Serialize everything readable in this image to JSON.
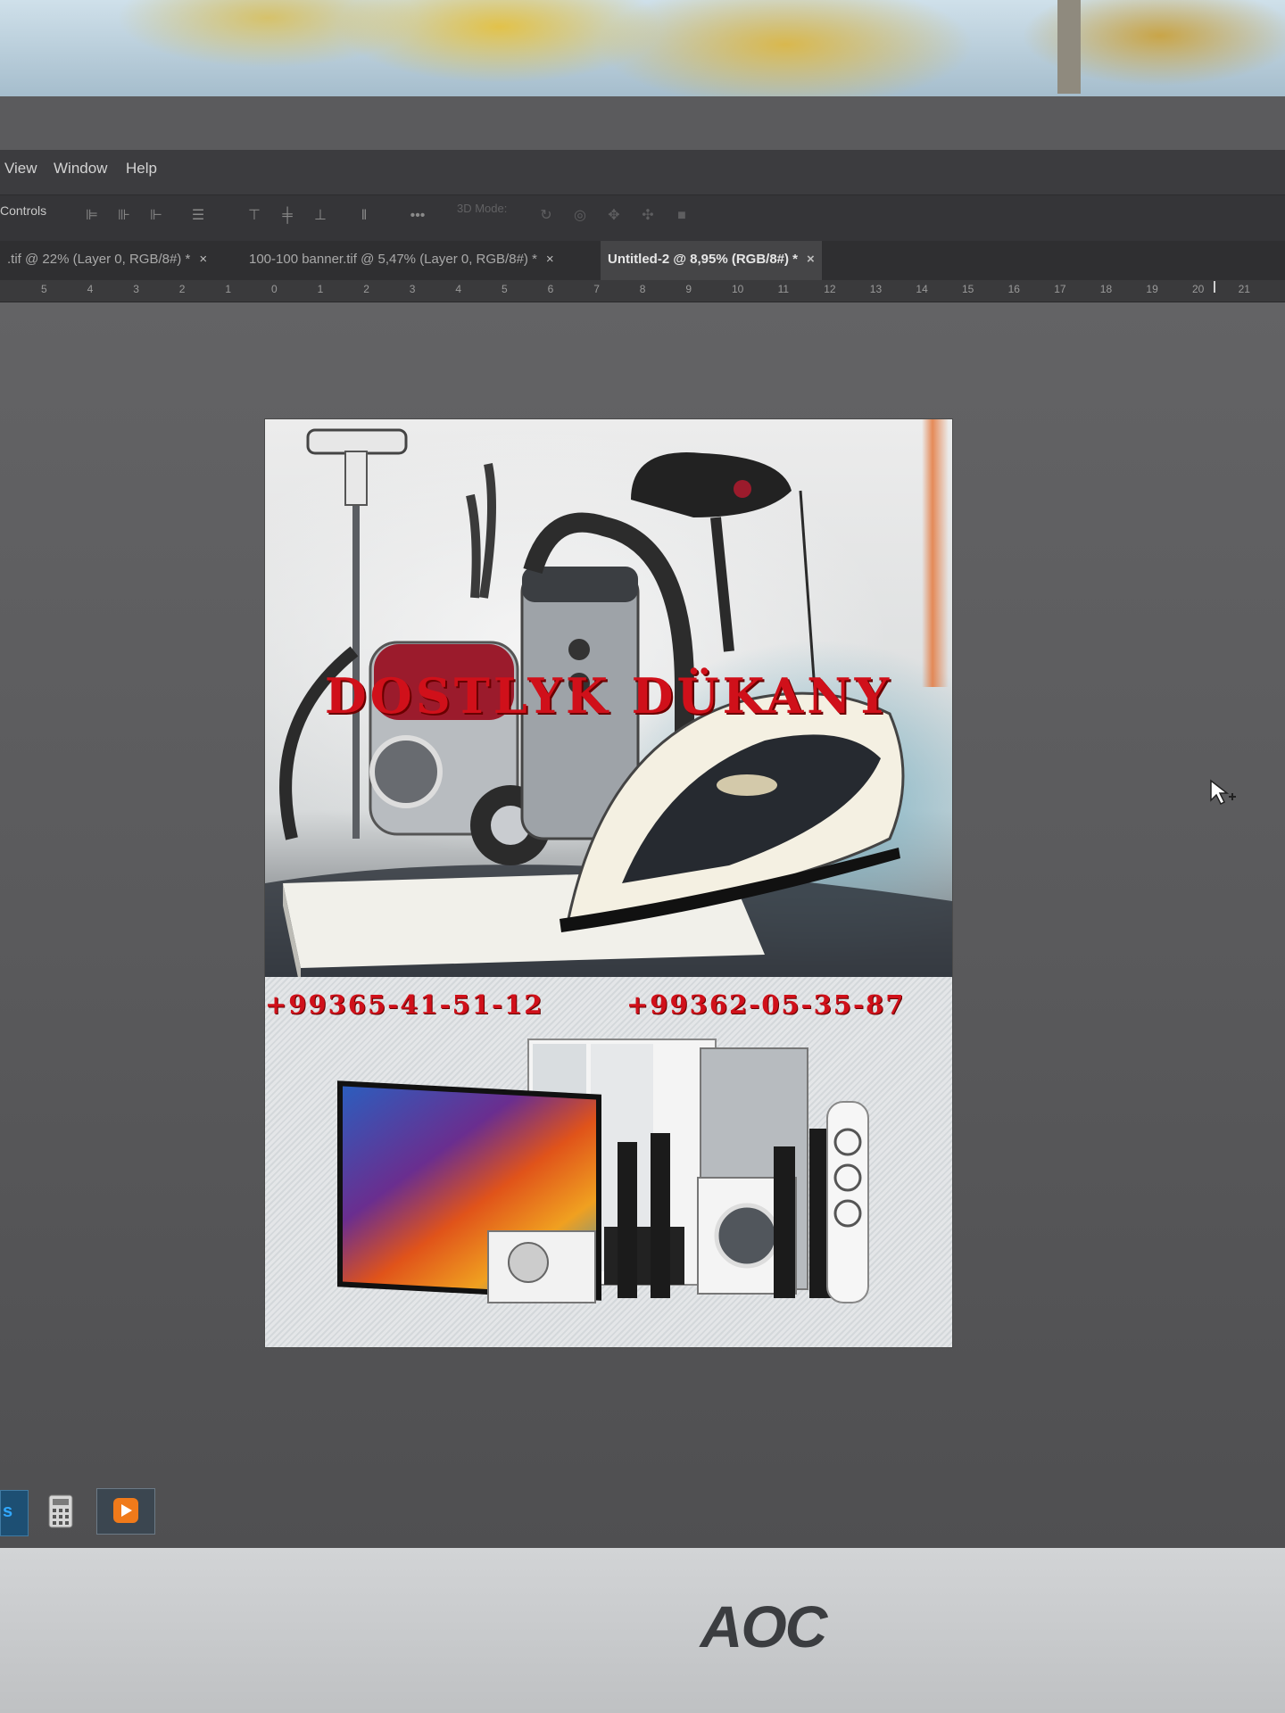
{
  "menu": [
    "View",
    "Window",
    "Help"
  ],
  "options_bar": {
    "label": "Controls",
    "mode_3d_label": "3D Mode:",
    "more_icon": "more-icon"
  },
  "tabs": [
    {
      "label": ".tif @ 22% (Layer 0, RGB/8#) *",
      "close": "×",
      "active": false
    },
    {
      "label": "100-100 banner.tif @ 5,47% (Layer 0, RGB/8#) *",
      "close": "×",
      "active": false
    },
    {
      "label": "Untitled-2 @ 8,95% (RGB/8#) *",
      "close": "×",
      "active": true
    }
  ],
  "ruler": [
    "5",
    "4",
    "3",
    "2",
    "1",
    "0",
    "1",
    "2",
    "3",
    "4",
    "5",
    "6",
    "7",
    "8",
    "9",
    "10",
    "11",
    "12",
    "13",
    "14",
    "15",
    "16",
    "17",
    "18",
    "19",
    "20",
    "21"
  ],
  "document": {
    "title": "DOSTLYK DÜKANY",
    "phone_1": "+99365-41-51-12",
    "phone_2": "+99362-05-35-87",
    "colors": {
      "brand_red": "#d0101a"
    }
  },
  "taskbar": {
    "apps": [
      "photoshop-icon",
      "calculator-icon",
      "media-player-icon"
    ]
  },
  "monitor_brand": "AOC"
}
